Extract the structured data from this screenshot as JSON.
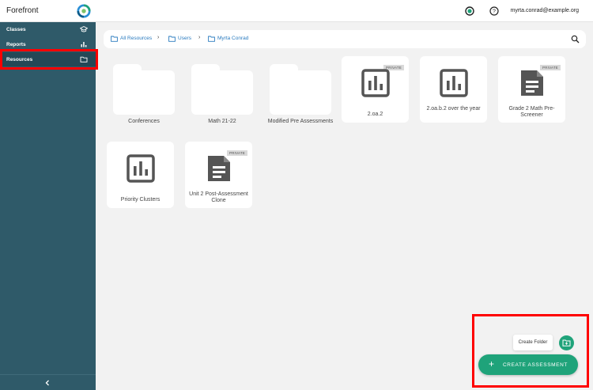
{
  "app": {
    "brand": "Forefront"
  },
  "header": {
    "user_email": "myrta.conrad@example.org"
  },
  "sidebar": {
    "items": [
      {
        "label": "Classes",
        "icon": "graduation-cap-icon"
      },
      {
        "label": "Reports",
        "icon": "bar-chart-icon"
      },
      {
        "label": "Resources",
        "icon": "folder-icon",
        "active": true
      }
    ]
  },
  "breadcrumb": {
    "items": [
      "All Resources",
      "Users",
      "Myrta Conrad"
    ]
  },
  "folders": [
    {
      "name": "Conferences"
    },
    {
      "name": "Math 21-22"
    },
    {
      "name": "Modified Pre Assessments"
    }
  ],
  "assessments": [
    {
      "name": "2.oa.2",
      "icon": "report-chart-icon",
      "badge": "PRIVATE"
    },
    {
      "name": "2.oa.b.2 over the year",
      "icon": "report-chart-icon",
      "badge": ""
    },
    {
      "name": "Grade 2 Math Pre-Screener",
      "icon": "document-icon",
      "badge": "PRIVATE"
    },
    {
      "name": "Priority Clusters",
      "icon": "report-chart-icon",
      "badge": ""
    },
    {
      "name": "Unit 2 Post-Assessment Clone",
      "icon": "document-icon",
      "badge": "PRIVATE"
    }
  ],
  "actions": {
    "create_folder_label": "Create Folder",
    "create_assessment_label": "CREATE ASSESSMENT"
  },
  "colors": {
    "sidebar": "#2f5a69",
    "accent": "#1fa37a",
    "link": "#2a7bbf",
    "highlight": "#ff0000"
  }
}
